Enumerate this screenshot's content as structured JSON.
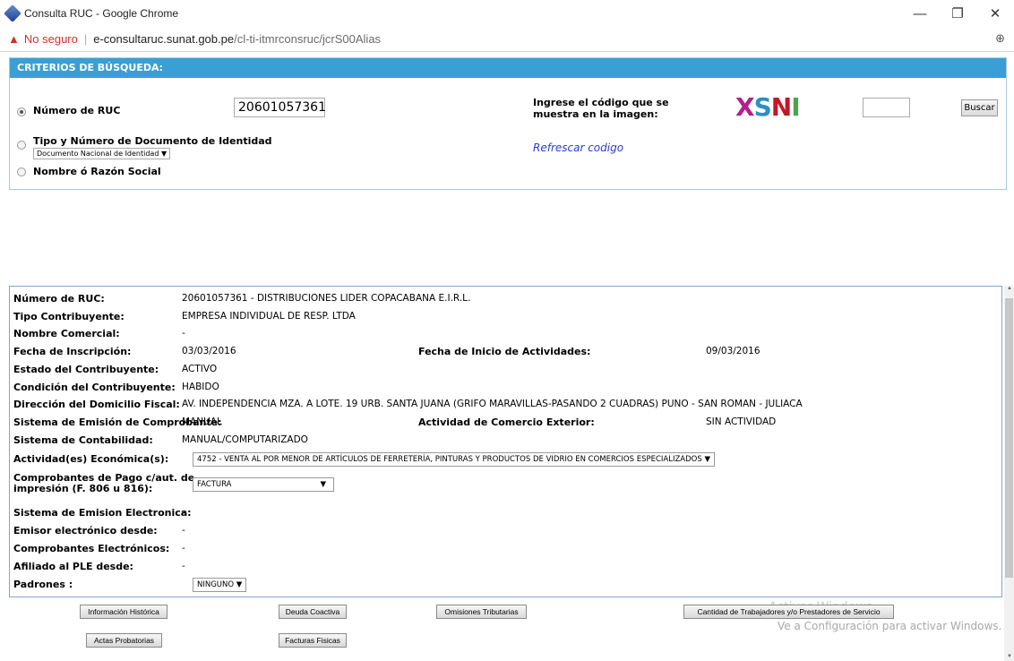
{
  "window": {
    "title": "Consulta RUC - Google Chrome",
    "minimize_glyph": "—",
    "restore_glyph": "❐",
    "close_glyph": "✕"
  },
  "address_bar": {
    "not_secure": "No seguro",
    "warning_icon": "▲",
    "host": "e-consultaruc.sunat.gob.pe",
    "path": "/cl-ti-itmrconsruc/jcrS00Alias",
    "zoom_icon": "⊕"
  },
  "criteria": {
    "header": "CRITERIOS DE BÚSQUEDA:",
    "ruc_label": "Número de RUC",
    "ruc_value": "20601057361",
    "doc_label": "Tipo y Número de Documento de Identidad",
    "doc_type_selected": "Documento Nacional de Identidad ▼",
    "name_label": "Nombre ó Razón Social",
    "captcha_label": "Ingrese el código que se muestra en la imagen:",
    "captcha_text": "XSNI",
    "captcha_colors": [
      "#b31f8c",
      "#2f8ec4",
      "#c4162a",
      "#4aa64a"
    ],
    "search_button": "Buscar",
    "refresh_link": "Refrescar codigo"
  },
  "result": {
    "ruc_label": "Número de RUC:",
    "ruc_value": "20601057361 - DISTRIBUCIONES LIDER COPACABANA E.I.R.L.",
    "tipo_label": "Tipo Contribuyente:",
    "tipo_value": "EMPRESA INDIVIDUAL DE RESP. LTDA",
    "nombre_comercial_label": "Nombre Comercial:",
    "nombre_comercial_value": "-",
    "fecha_inscripcion_label": "Fecha de Inscripción:",
    "fecha_inscripcion_value": "03/03/2016",
    "fecha_inicio_label": "Fecha de Inicio de Actividades:",
    "fecha_inicio_value": "09/03/2016",
    "estado_label": "Estado del Contribuyente:",
    "estado_value": "ACTIVO",
    "condicion_label": "Condición del Contribuyente:",
    "condicion_value": "HABIDO",
    "domicilio_label": "Dirección del Domicilio Fiscal:",
    "domicilio_value": "AV. INDEPENDENCIA MZA. A LOTE. 19 URB. SANTA JUANA (GRIFO MARAVILLAS-PASANDO 2 CUADRAS) PUNO - SAN ROMAN - JULIACA",
    "emision_label": "Sistema de Emisión de Comprobante:",
    "emision_value": "MANUAL",
    "comercio_label": "Actividad de Comercio Exterior:",
    "comercio_value": "SIN ACTIVIDAD",
    "contabilidad_label": "Sistema de Contabilidad:",
    "contabilidad_value": "MANUAL/COMPUTARIZADO",
    "actividad_label": "Actividad(es) Económica(s):",
    "actividad_value": "4752 - VENTA AL POR MENOR DE ARTÍCULOS DE FERRETERÍA, PINTURAS Y PRODUCTOS DE VIDRIO EN COMERCIOS ESPECIALIZADOS ▼",
    "comprobantes_label_1": "Comprobantes de Pago c/aut. de",
    "comprobantes_label_2": "impresión (F. 806 u 816):",
    "comprobantes_value": "FACTURA",
    "comprobantes_arrow": "▼",
    "emision_electronica_label": "Sistema de Emision Electronica:",
    "emision_electronica_value": "-",
    "emisor_desde_label": "Emisor electrónico desde:",
    "emisor_desde_value": "-",
    "comprobantes_electronicos_label": "Comprobantes Electrónicos:",
    "comprobantes_electronicos_value": "-",
    "ple_label": "Afiliado al PLE desde:",
    "ple_value": "-",
    "padrones_label": "Padrones :",
    "padrones_value": "NINGUNO ▼"
  },
  "actions": {
    "historica": "Información Histórica",
    "deuda": "Deuda Coactiva",
    "omisiones": "Omisiones Tributarias",
    "trabajadores": "Cantidad de Trabajadores y/o Prestadores de Servicio",
    "actas": "Actas Probatorias",
    "facturas": "Facturas Fisicas"
  },
  "watermark": {
    "line1": "Activar Windows",
    "line2": "Ve a Configuración para activar Windows."
  }
}
